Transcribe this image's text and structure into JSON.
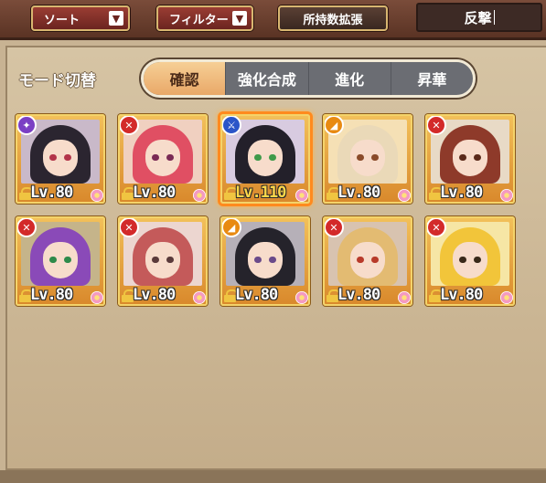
{
  "header": {
    "sort_label": "ソート",
    "filter_label": "フィルター",
    "expand_label": "所持数拡張",
    "caret": "▼",
    "search_value": "反撃"
  },
  "mode": {
    "label": "モード切替",
    "tabs": [
      "確認",
      "強化合成",
      "進化",
      "昇華"
    ],
    "active_index": 0
  },
  "units": [
    {
      "level": "Lv.80",
      "rarity_icon": "purple-class-icon",
      "rarity_color": "#7b3fc4",
      "hair": "#2b2530",
      "eyes": "#b3344a",
      "bg": "#c9b9c9",
      "gold": false
    },
    {
      "level": "Lv.80",
      "rarity_icon": "red-class-icon",
      "rarity_color": "#d32a2a",
      "hair": "#e04f63",
      "eyes": "#7a2a55",
      "bg": "#f0d0c0",
      "gold": false
    },
    {
      "level": "Lv.110",
      "rarity_icon": "blue-class-icon",
      "rarity_color": "#2a55c8",
      "hair": "#23202a",
      "eyes": "#3f9a4a",
      "bg": "#d8cbe0",
      "gold": true
    },
    {
      "level": "Lv.80",
      "rarity_icon": "orange-class-icon",
      "rarity_color": "#e88a12",
      "hair": "#ead9b8",
      "eyes": "#8a4b2a",
      "bg": "#f5e0b5",
      "gold": false
    },
    {
      "level": "Lv.80",
      "rarity_icon": "red-class-icon",
      "rarity_color": "#d32a2a",
      "hair": "#8e3a2a",
      "eyes": "#5a2a1a",
      "bg": "#e8dac6",
      "gold": false
    },
    {
      "level": "Lv.80",
      "rarity_icon": "red-class-icon",
      "rarity_color": "#d32a2a",
      "hair": "#8a4ab8",
      "eyes": "#2e8a4a",
      "bg": "#c5b48a",
      "gold": false
    },
    {
      "level": "Lv.80",
      "rarity_icon": "red-class-icon",
      "rarity_color": "#d32a2a",
      "hair": "#c45a5a",
      "eyes": "#5a3a3a",
      "bg": "#ecd6d0",
      "gold": false
    },
    {
      "level": "Lv.80",
      "rarity_icon": "orange-class-icon",
      "rarity_color": "#e88a12",
      "hair": "#25232b",
      "eyes": "#6a4a8a",
      "bg": "#b6b0b8",
      "gold": false
    },
    {
      "level": "Lv.80",
      "rarity_icon": "red-class-icon",
      "rarity_color": "#d32a2a",
      "hair": "#e3bb72",
      "eyes": "#b83a2a",
      "bg": "#d8c3b0",
      "gold": false
    },
    {
      "level": "Lv.80",
      "rarity_icon": "red-class-icon",
      "rarity_color": "#d32a2a",
      "hair": "#f2c53a",
      "eyes": "#3a2a1a",
      "bg": "#f6e6a5",
      "gold": false
    }
  ],
  "selected_index": 2
}
